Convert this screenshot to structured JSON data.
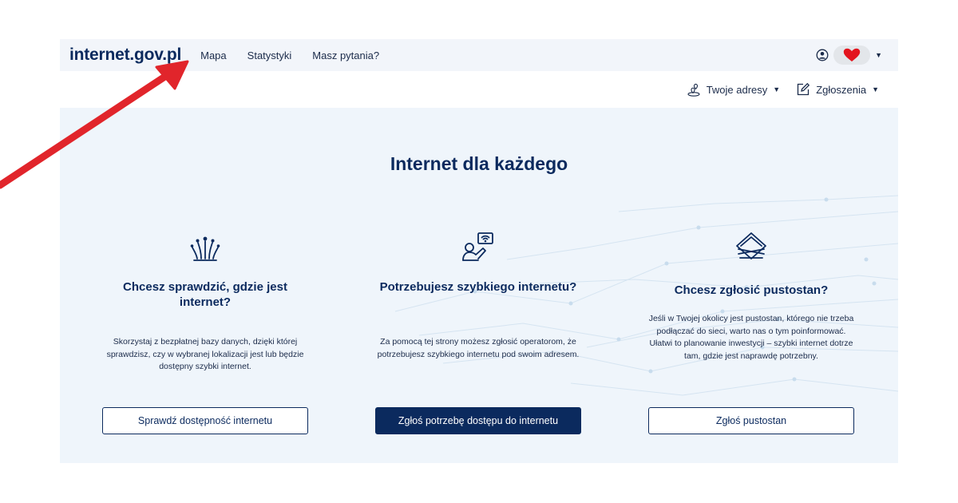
{
  "header": {
    "brand": "internet.gov.pl",
    "nav": [
      {
        "label": "Mapa"
      },
      {
        "label": "Statystyki"
      },
      {
        "label": "Masz pytania?"
      }
    ]
  },
  "subbar": {
    "addresses_label": "Twoje adresy",
    "reports_label": "Zgłoszenia"
  },
  "hero": {
    "title": "Internet dla każdego",
    "columns": [
      {
        "title": "Chcesz sprawdzić, gdzie jest internet?",
        "text": "Skorzystaj z bezpłatnej bazy danych, dzięki której sprawdzisz, czy w wybranej lokalizacji jest lub będzie dostępny szybki internet.",
        "button": "Sprawdź dostępność internetu"
      },
      {
        "title": "Potrzebujesz szybkiego internetu?",
        "text": "Za pomocą tej strony możesz zgłosić operatorom, że potrzebujesz szybkiego internetu pod swoim adresem.",
        "button": "Zgłoś potrzebę dostępu do internetu"
      },
      {
        "title": "Chcesz zgłosić pustostan?",
        "text": "Jeśli w Twojej okolicy jest pustostan, którego nie trzeba podłączać do sieci, warto nas o tym poinformować. Ułatwi to planowanie inwestycji – szybki internet dotrze tam, gdzie jest naprawdę potrzebny.",
        "button": "Zgłoś pustostan"
      }
    ]
  },
  "colors": {
    "brand": "#0b2a5e",
    "hero_bg": "#eff5fb",
    "arrow": "#e1252b",
    "heart": "#e3141e"
  }
}
